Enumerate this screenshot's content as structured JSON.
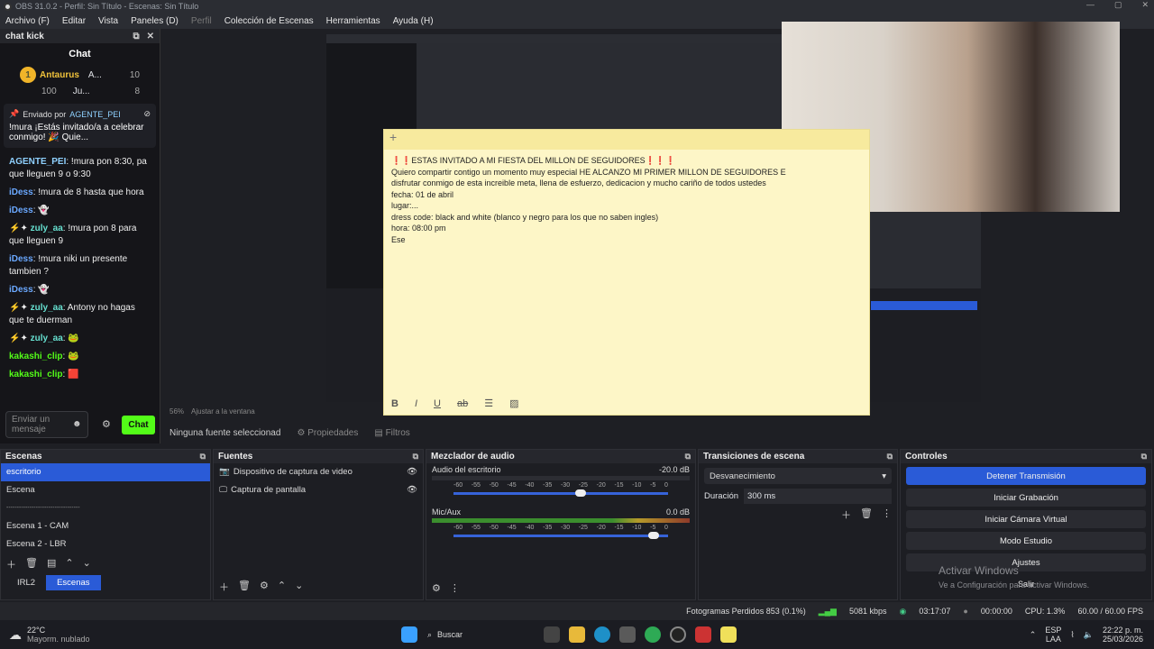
{
  "window": {
    "title": "OBS 31.0.2 - Perfil: Sin Título - Escenas: Sin Título"
  },
  "menu": [
    "Archivo (F)",
    "Editar",
    "Vista",
    "Paneles (D)",
    "Perfil",
    "Colección de Escenas",
    "Herramientas",
    "Ayuda (H)"
  ],
  "chat": {
    "dock_title": "chat kick",
    "title": "Chat",
    "leaders": [
      {
        "rank": "1",
        "name": "Antaurus",
        "count": "100"
      },
      {
        "name": "A...",
        "count": "10"
      },
      {
        "name": "Ju...",
        "count": "8"
      }
    ],
    "pinned": {
      "label": "Enviado por",
      "user": "AGENTE_PEI",
      "text": "!mura ¡Estás invitado/a a celebrar conmigo! 🎉 Quie..."
    },
    "messages": [
      {
        "user": "AGENTE_PEI",
        "text": ": !mura pon 8:30, pa que lleguen 9 o 9:30"
      },
      {
        "user": "iDess",
        "text": ": !mura de 8 hasta que hora"
      },
      {
        "user": "iDess",
        "text": ":"
      },
      {
        "user": "zuly_aa",
        "text": ": !mura pon 8 para que lleguen 9"
      },
      {
        "user": "iDess",
        "text": ": !mura niki un presente tambien ?"
      },
      {
        "user": "iDess",
        "text": ":"
      },
      {
        "user": "zuly_aa",
        "text": ": Antony no hagas que te duerman"
      },
      {
        "user": "zuly_aa",
        "text": ":"
      },
      {
        "user": "kakashi_clip",
        "text": ":"
      },
      {
        "user": "kakashi_clip",
        "text": ":"
      }
    ],
    "input_placeholder": "Enviar un mensaje",
    "send": "Chat"
  },
  "note": {
    "lines": [
      "❗❗ESTAS INVITADO A MI FIESTA DEL MILLON DE SEGUIDORES❗❗❗",
      "Quiero compartir contigo un momento muy especial HE ALCANZO MI PRIMER MILLON DE SEGUIDORES E",
      "disfrutar conmigo de esta increible meta, llena de esfuerzo, dedicacion y mucho cariño de todos ustedes",
      "fecha: 01 de abril",
      "lugar:...",
      "dress code: black and white (blanco y negro para los que no saben ingles)",
      "hora: 08:00 pm",
      "Ese"
    ]
  },
  "preview": {
    "zoom": "56%",
    "fit": "Ajustar a la ventana"
  },
  "sourcebar": {
    "none": "Ninguna fuente seleccionad",
    "props": "Propiedades",
    "filters": "Filtros"
  },
  "scenes": {
    "title": "Escenas",
    "items": [
      "escritorio",
      "Escena",
      "-----------------------------------",
      "Escena 1 - CAM",
      "Escena 2 - LBR"
    ],
    "tabs": [
      "IRL2",
      "Escenas"
    ]
  },
  "sources": {
    "title": "Fuentes",
    "items": [
      "Dispositivo de captura de video",
      "Captura de pantalla"
    ]
  },
  "mixer": {
    "title": "Mezclador de audio",
    "ch1": {
      "name": "Audio del escritorio",
      "db": "-20.0 dB"
    },
    "ch2": {
      "name": "Mic/Aux",
      "db": "0.0 dB"
    },
    "scale": [
      "-60",
      "-55",
      "-50",
      "-45",
      "-40",
      "-35",
      "-30",
      "-25",
      "-20",
      "-15",
      "-10",
      "-5",
      "0"
    ],
    "vol1": 0.62,
    "vol2": 1.0
  },
  "transitions": {
    "title": "Transiciones de escena",
    "type": "Desvanecimiento",
    "dur_label": "Duración",
    "duration": "300 ms"
  },
  "controls": {
    "title": "Controles",
    "buttons": [
      "Detener Transmisión",
      "Iniciar Grabación",
      "Iniciar Cámara Virtual",
      "Modo Estudio",
      "Ajustes",
      "Salir"
    ]
  },
  "watermark": {
    "line1": "Activar Windows",
    "line2": "Ve a Configuración para activar Windows."
  },
  "status": {
    "frames": "Fotogramas Perdidos 853 (0.1%)",
    "kbps": "5081 kbps",
    "live": "03:17:07",
    "rec": "00:00:00",
    "cpu": "CPU: 1.3%",
    "fps": "60.00 / 60.00 FPS"
  },
  "taskbar": {
    "weather_temp": "22°C",
    "weather": "Mayorm. nublado",
    "search": "Buscar",
    "lang1": "ESP",
    "lang2": "LAA",
    "time": "22:22 p. m.",
    "date": "25/03/2026"
  }
}
